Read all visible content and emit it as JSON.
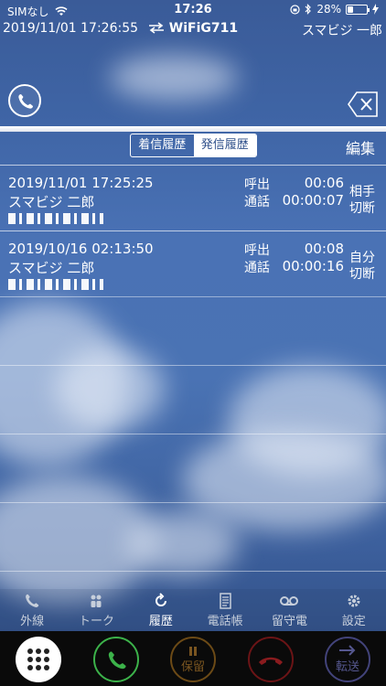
{
  "status_bar": {
    "carrier": "SIMなし",
    "time": "17:26",
    "battery_text": "28%",
    "battery_level": 0.28,
    "icons": [
      "wifi-icon",
      "rotation-lock-icon",
      "bluetooth-icon",
      "charging-icon"
    ]
  },
  "info_bar": {
    "datetime": "2019/11/01 17:26:55",
    "connection_icon": "transfer-arrows-icon",
    "connection": "WiFiG711",
    "user": "スマビジ 一郎"
  },
  "dial": {
    "call_icon": "phone-icon",
    "delete_icon": "backspace-icon"
  },
  "history": {
    "tabs": [
      {
        "label": "着信履歴",
        "active": false
      },
      {
        "label": "発信履歴",
        "active": true
      }
    ],
    "edit_label": "編集",
    "entries": [
      {
        "datetime": "2019/11/01 17:25:25",
        "name": "スマビジ 二郎",
        "ring_label": "呼出",
        "ring_time": "00:06",
        "talk_label": "通話",
        "talk_time": "00:00:07",
        "end_line1": "相手",
        "end_line2": "切断"
      },
      {
        "datetime": "2019/10/16 02:13:50",
        "name": "スマビジ 二郎",
        "ring_label": "呼出",
        "ring_time": "00:08",
        "talk_label": "通話",
        "talk_time": "00:00:16",
        "end_line1": "自分",
        "end_line2": "切断"
      }
    ]
  },
  "tab_bar": [
    {
      "label": "外線",
      "icon": "phone-icon",
      "active": false
    },
    {
      "label": "トーク",
      "icon": "people-icon",
      "active": false
    },
    {
      "label": "履歴",
      "icon": "history-icon",
      "active": true
    },
    {
      "label": "電話帳",
      "icon": "phonebook-icon",
      "active": false
    },
    {
      "label": "留守電",
      "icon": "voicemail-icon",
      "active": false
    },
    {
      "label": "設定",
      "icon": "gear-icon",
      "active": false
    }
  ],
  "action_bar": {
    "keypad_icon": "keypad-icon",
    "call_icon": "phone-icon",
    "hold_label": "保留",
    "hold_icon": "pause-icon",
    "hangup_icon": "hangup-icon",
    "transfer_label": "転送",
    "transfer_icon": "arrow-right-icon",
    "colors": {
      "call": "#3cb24a",
      "hold": "#6c4a16",
      "hangup": "#6b1416",
      "transfer": "#42437a"
    }
  }
}
